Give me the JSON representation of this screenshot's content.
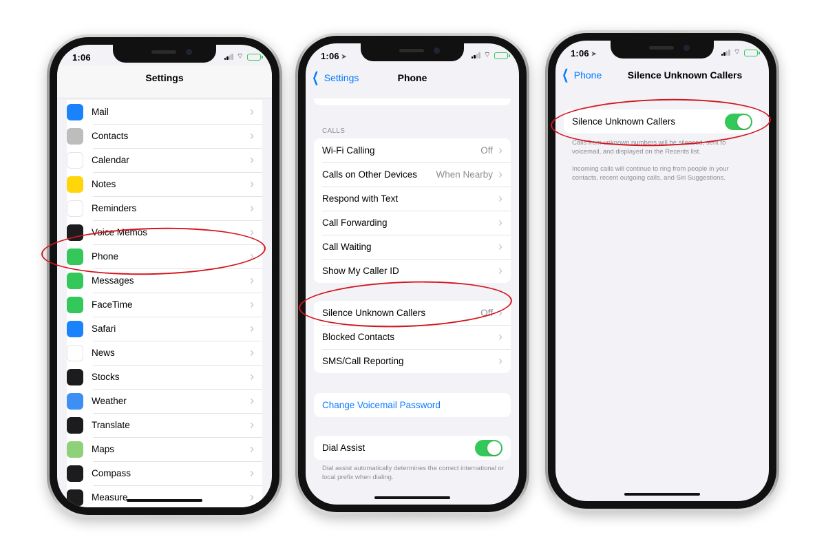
{
  "status": {
    "time": "1:06"
  },
  "phone1": {
    "title": "Settings",
    "items": [
      {
        "label": "Mail",
        "icon": "mail-icon",
        "color": "#1a82fb"
      },
      {
        "label": "Contacts",
        "icon": "contacts-icon",
        "color": "#bdbdbd"
      },
      {
        "label": "Calendar",
        "icon": "calendar-icon",
        "color": "#ffffff"
      },
      {
        "label": "Notes",
        "icon": "notes-icon",
        "color": "#ffd60a"
      },
      {
        "label": "Reminders",
        "icon": "reminders-icon",
        "color": "#ffffff"
      },
      {
        "label": "Voice Memos",
        "icon": "voice-memos-icon",
        "color": "#1c1c1e"
      },
      {
        "label": "Phone",
        "icon": "phone-icon",
        "color": "#34c759"
      },
      {
        "label": "Messages",
        "icon": "messages-icon",
        "color": "#34c759"
      },
      {
        "label": "FaceTime",
        "icon": "facetime-icon",
        "color": "#34c759"
      },
      {
        "label": "Safari",
        "icon": "safari-icon",
        "color": "#1a82fb"
      },
      {
        "label": "News",
        "icon": "news-icon",
        "color": "#ffffff"
      },
      {
        "label": "Stocks",
        "icon": "stocks-icon",
        "color": "#1c1c1e"
      },
      {
        "label": "Weather",
        "icon": "weather-icon",
        "color": "#3d8ff5"
      },
      {
        "label": "Translate",
        "icon": "translate-icon",
        "color": "#1c1c1e"
      },
      {
        "label": "Maps",
        "icon": "maps-icon",
        "color": "#8fd17a"
      },
      {
        "label": "Compass",
        "icon": "compass-icon",
        "color": "#1c1c1e"
      },
      {
        "label": "Measure",
        "icon": "measure-icon",
        "color": "#1c1c1e"
      }
    ]
  },
  "phone2": {
    "back_label": "Settings",
    "title": "Phone",
    "calls_header": "CALLS",
    "calls_rows": [
      {
        "label": "Wi-Fi Calling",
        "value": "Off"
      },
      {
        "label": "Calls on Other Devices",
        "value": "When Nearby"
      },
      {
        "label": "Respond with Text",
        "value": ""
      },
      {
        "label": "Call Forwarding",
        "value": ""
      },
      {
        "label": "Call Waiting",
        "value": ""
      },
      {
        "label": "Show My Caller ID",
        "value": ""
      }
    ],
    "blocking_rows": [
      {
        "label": "Silence Unknown Callers",
        "value": "Off"
      },
      {
        "label": "Blocked Contacts",
        "value": ""
      },
      {
        "label": "SMS/Call Reporting",
        "value": ""
      }
    ],
    "voicemail_label": "Change Voicemail Password",
    "dial_assist_label": "Dial Assist",
    "dial_assist_on": true,
    "dial_assist_footer": "Dial assist automatically determines the correct international or local prefix when dialing."
  },
  "phone3": {
    "back_label": "Phone",
    "title": "Silence Unknown Callers",
    "toggle_label": "Silence Unknown Callers",
    "toggle_on": true,
    "footer_1": "Calls from unknown numbers will be silenced, sent to voicemail, and displayed on the Recents list.",
    "footer_2": "Incoming calls will continue to ring from people in your contacts, recent outgoing calls, and Siri Suggestions."
  },
  "colors": {
    "annotation_red": "#d4141c",
    "ios_blue": "#007aff",
    "toggle_green": "#34c759"
  }
}
